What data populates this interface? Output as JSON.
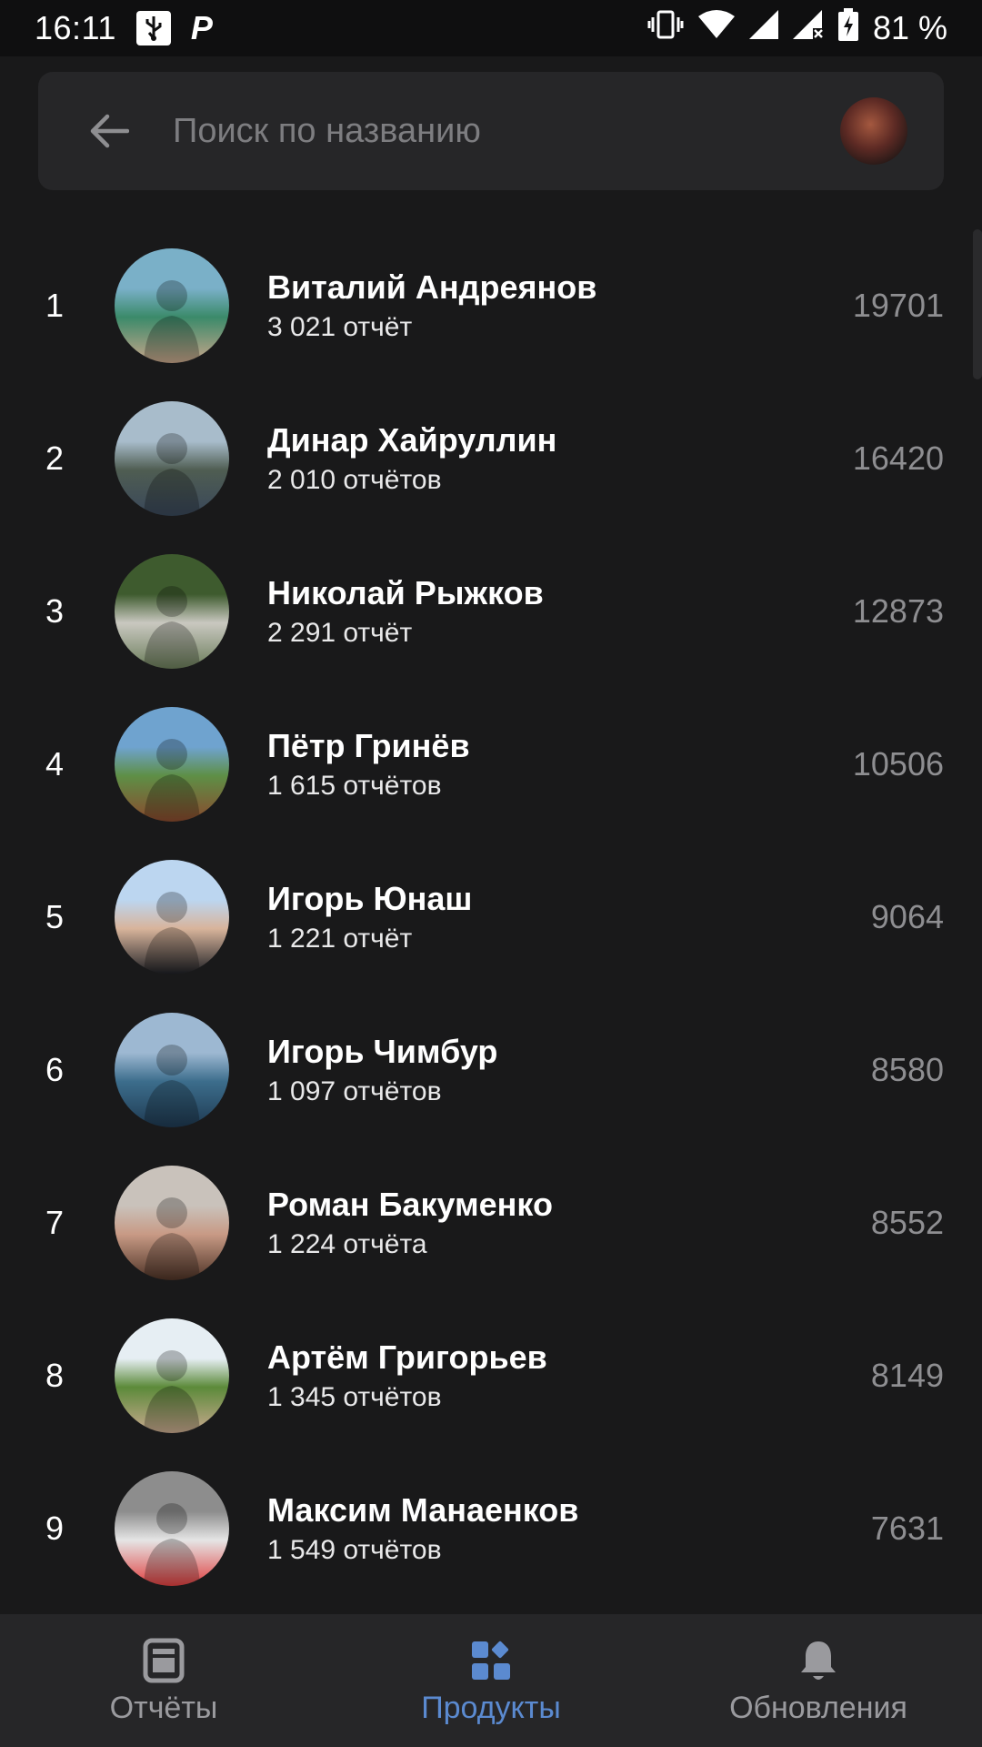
{
  "status_bar": {
    "time": "16:11",
    "battery_text": "81 %",
    "icons": [
      "usb-icon",
      "parking-app-icon",
      "vibrate-icon",
      "wifi-icon",
      "signal-icon",
      "signal-no-data-icon",
      "battery-charging-icon"
    ]
  },
  "search": {
    "placeholder": "Поиск по названию",
    "value": ""
  },
  "leaderboard": [
    {
      "rank": "1",
      "name": "Виталий Андреянов",
      "reports": "3 021 отчёт",
      "score": "19701",
      "avatar_colors": [
        "#7ab0c8",
        "#3b8a6a",
        "#c8a58a"
      ]
    },
    {
      "rank": "2",
      "name": "Динар Хайруллин",
      "reports": "2 010 отчётов",
      "score": "16420",
      "avatar_colors": [
        "#a8bccb",
        "#4f5d52",
        "#39475a"
      ]
    },
    {
      "rank": "3",
      "name": "Николай Рыжков",
      "reports": "2 291 отчёт",
      "score": "12873",
      "avatar_colors": [
        "#3e5b2e",
        "#c9c8c0",
        "#6b7d5a"
      ]
    },
    {
      "rank": "4",
      "name": "Пётр Гринёв",
      "reports": "1 615 отчётов",
      "score": "10506",
      "avatar_colors": [
        "#6fa3cf",
        "#5e8f46",
        "#8a4a2e"
      ]
    },
    {
      "rank": "5",
      "name": "Игорь Юнаш",
      "reports": "1 221 отчёт",
      "score": "9064",
      "avatar_colors": [
        "#bcd6f0",
        "#d8b49b",
        "#1d1f24"
      ]
    },
    {
      "rank": "6",
      "name": "Игорь Чимбур",
      "reports": "1 097 отчётов",
      "score": "8580",
      "avatar_colors": [
        "#9db8d2",
        "#3c6d8c",
        "#1f3a52"
      ]
    },
    {
      "rank": "7",
      "name": "Роман Бакуменко",
      "reports": "1 224 отчёта",
      "score": "8552",
      "avatar_colors": [
        "#c9c2bb",
        "#c89a85",
        "#4e3326"
      ]
    },
    {
      "rank": "8",
      "name": "Артём Григорьев",
      "reports": "1 345 отчётов",
      "score": "8149",
      "avatar_colors": [
        "#e6eef3",
        "#5c8a3a",
        "#c9a98f"
      ]
    },
    {
      "rank": "9",
      "name": "Максим Манаенков",
      "reports": "1 549 отчётов",
      "score": "7631",
      "avatar_colors": [
        "#8d8d8d",
        "#e5e5e5",
        "#e04040"
      ]
    }
  ],
  "bottom_nav": {
    "items": [
      {
        "label": "Отчёты",
        "icon": "reports-icon",
        "active": false
      },
      {
        "label": "Продукты",
        "icon": "products-icon",
        "active": true
      },
      {
        "label": "Обновления",
        "icon": "bell-icon",
        "active": false
      }
    ],
    "active_color": "#5b8ad0",
    "inactive_color": "#9a9a9e"
  },
  "colors": {
    "background": "#19191a",
    "surface": "#262628",
    "score_text": "#8e8e91"
  }
}
